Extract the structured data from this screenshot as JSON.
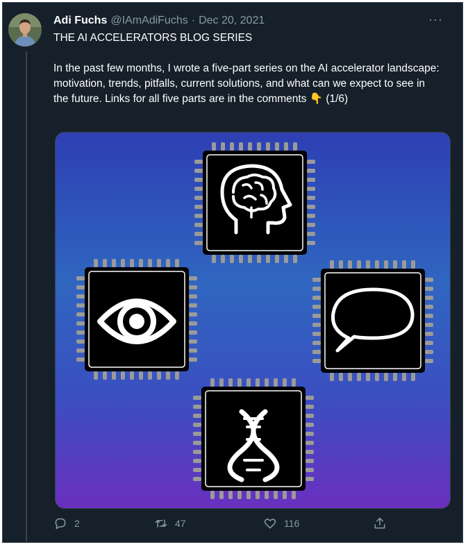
{
  "tweet": {
    "author_name": "Adi Fuchs",
    "author_handle": "@IAmAdiFuchs",
    "separator": "·",
    "date": "Dec 20, 2021",
    "more_label": "···",
    "title_line": "THE AI ACCELERATORS BLOG SERIES",
    "body": "In the past few months, I wrote a five-part series on the AI accelerator landscape: motivation, trends, pitfalls, current solutions, and what can we expect to see in the future. Links for all five parts are in the comments 👇 (1/6)"
  },
  "media": {
    "chips": [
      "brain-icon",
      "eye-icon",
      "speech-bubble-icon",
      "dna-icon"
    ],
    "colors": {
      "top": "#2e3fb3",
      "middle": "#2f66c0",
      "bottom": "#6a2fbf"
    }
  },
  "actions": {
    "reply_count": "2",
    "retweet_count": "47",
    "like_count": "116",
    "icons": [
      "reply-icon",
      "retweet-icon",
      "like-icon",
      "share-icon"
    ]
  },
  "colors": {
    "background": "#15202b",
    "text": "#ffffff",
    "muted": "#8b98a5",
    "border": "#38444d"
  }
}
